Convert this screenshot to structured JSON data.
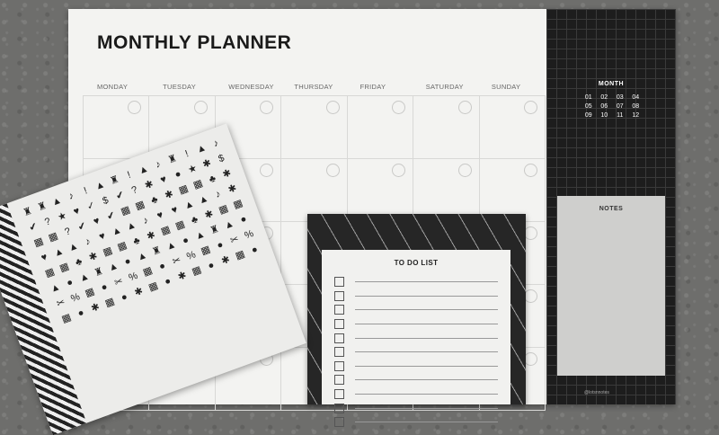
{
  "planner": {
    "title": "MONTHLY PLANNER",
    "days": [
      "MONDAY",
      "TUESDAY",
      "WEDNESDAY",
      "THURSDAY",
      "FRIDAY",
      "SATURDAY",
      "SUNDAY"
    ],
    "month_label": "MONTH",
    "months": [
      "01",
      "02",
      "03",
      "04",
      "05",
      "06",
      "07",
      "08",
      "09",
      "10",
      "11",
      "12"
    ],
    "notes_label": "NOTES",
    "handle": "@lotsnnotes"
  },
  "todo": {
    "title": "TO DO LIST",
    "row_count": 11
  },
  "stickers": {
    "glyphs": [
      "♜",
      "♜",
      "▲",
      "♪",
      "!",
      "▲",
      "♜",
      "!",
      "▲",
      "♪",
      "♜",
      "!",
      "▲",
      "♪",
      "✔",
      "?",
      "★",
      "♥",
      "✓",
      "$",
      "✔",
      "?",
      "✱",
      "♥",
      "●",
      "★",
      "✱",
      "$",
      "▦",
      "▦",
      "?",
      "✔",
      "♥",
      "✔",
      "▦",
      "▦",
      "♣",
      "✱",
      "▦",
      "▦",
      "♣",
      "✱",
      "♥",
      "▲",
      "▲",
      "♪",
      "♥",
      "▲",
      "▲",
      "♪",
      "♥",
      "♥",
      "▲",
      "▲",
      "♪",
      "✱",
      "▦",
      "▦",
      "♣",
      "✱",
      "▦",
      "▦",
      "♣",
      "✱",
      "▦",
      "▦",
      "♣",
      "✱",
      "▦",
      "▦",
      "▲",
      "●",
      "▲",
      "♜",
      "▲",
      "●",
      "▲",
      "♜",
      "▲",
      "●",
      "▲",
      "♜",
      "▲",
      "●",
      "✂",
      "%",
      "▦",
      "●",
      "✂",
      "%",
      "▦",
      "●",
      "✂",
      "%",
      "▦",
      "●",
      "✂",
      "%",
      "▦",
      "●",
      "✱",
      "▦",
      "●",
      "✱",
      "▦",
      "●",
      "✱",
      "▦",
      "●",
      "✱",
      "▦",
      "●"
    ]
  }
}
